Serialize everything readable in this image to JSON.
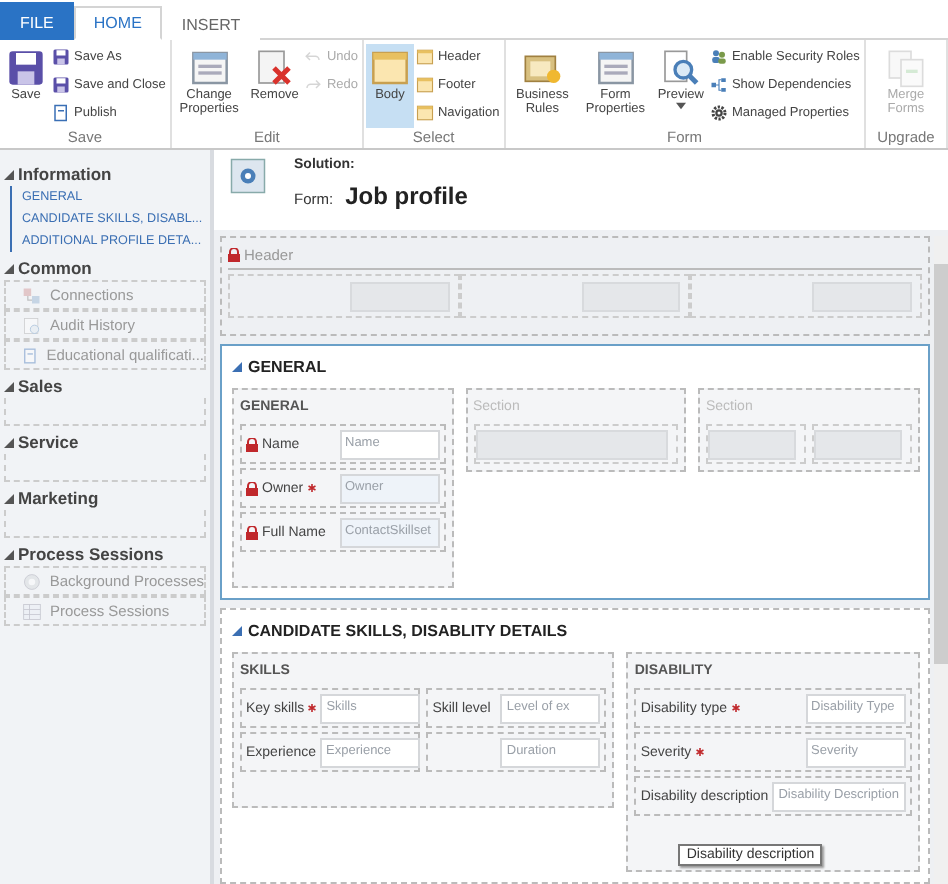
{
  "tabs": [
    {
      "label": "FILE",
      "kind": "file",
      "selected": false
    },
    {
      "label": "HOME",
      "kind": "tab",
      "selected": true
    },
    {
      "label": "INSERT",
      "kind": "tab",
      "selected": false
    }
  ],
  "ribbon_groups": [
    {
      "label": "Save",
      "columns": [
        [
          {
            "label": "Save",
            "kind": "large",
            "selected": false,
            "disabled": false
          }
        ],
        [
          {
            "label": "Save As",
            "kind": "small",
            "selected": false,
            "disabled": false
          },
          {
            "label": "Save and Close",
            "kind": "small",
            "selected": false,
            "disabled": false
          },
          {
            "label": "Publish",
            "kind": "small",
            "selected": false,
            "disabled": false
          }
        ]
      ]
    },
    {
      "label": "Edit",
      "columns": [
        [
          {
            "label": "Change Properties",
            "kind": "large",
            "selected": false,
            "disabled": false
          }
        ],
        [
          {
            "label": "Remove",
            "kind": "large",
            "selected": false,
            "disabled": false
          }
        ],
        [
          {
            "label": "Undo",
            "kind": "small",
            "selected": false,
            "disabled": true
          },
          {
            "label": "Redo",
            "kind": "small",
            "selected": false,
            "disabled": true
          }
        ]
      ]
    },
    {
      "label": "Select",
      "columns": [
        [
          {
            "label": "Body",
            "kind": "large",
            "selected": true,
            "disabled": false
          }
        ],
        [
          {
            "label": "Header",
            "kind": "small",
            "selected": false,
            "disabled": false
          },
          {
            "label": "Footer",
            "kind": "small",
            "selected": false,
            "disabled": false
          },
          {
            "label": "Navigation",
            "kind": "small",
            "selected": false,
            "disabled": false
          }
        ]
      ]
    },
    {
      "label": "Form",
      "columns": [
        [
          {
            "label": "Business Rules",
            "kind": "large",
            "selected": false,
            "disabled": false
          }
        ],
        [
          {
            "label": "Form Properties",
            "kind": "large",
            "selected": false,
            "disabled": false
          }
        ],
        [
          {
            "label": "Preview",
            "kind": "dropdown",
            "selected": false,
            "disabled": false
          }
        ],
        [
          {
            "label": "Enable Security Roles",
            "kind": "small",
            "selected": false,
            "disabled": false
          },
          {
            "label": "Show Dependencies",
            "kind": "small",
            "selected": false,
            "disabled": false
          },
          {
            "label": "Managed Properties",
            "kind": "small",
            "selected": false,
            "disabled": false
          }
        ]
      ]
    },
    {
      "label": "Upgrade",
      "columns": [
        [
          {
            "label": "Merge Forms",
            "kind": "large",
            "selected": false,
            "disabled": true
          }
        ]
      ]
    }
  ],
  "nav": [
    {
      "title": "Information",
      "items": [
        {
          "label": "GENERAL",
          "kind": "link"
        },
        {
          "label": "CANDIDATE SKILLS, DISABL...",
          "kind": "link"
        },
        {
          "label": "ADDITIONAL PROFILE DETA...",
          "kind": "link"
        }
      ]
    },
    {
      "title": "Common",
      "items": [
        {
          "label": "Connections",
          "kind": "item"
        },
        {
          "label": "Audit History",
          "kind": "item"
        },
        {
          "label": "Educational qualificati...",
          "kind": "item"
        }
      ]
    },
    {
      "title": "Sales"
    },
    {
      "title": "Service"
    },
    {
      "title": "Marketing"
    },
    {
      "title": "Process Sessions",
      "items": [
        {
          "label": "Background Processes",
          "kind": "item"
        },
        {
          "label": "Process Sessions",
          "kind": "item"
        }
      ]
    }
  ],
  "solution_label": "Solution:",
  "form_label": "Form:",
  "form_name": "Job profile",
  "header_block": {
    "label": "Header",
    "locked": true
  },
  "form_tabs": [
    {
      "title": "GENERAL",
      "selected": true,
      "sections": [
        {
          "title": "GENERAL",
          "kind": "fields",
          "rows": [
            [
              {
                "label": "Name",
                "locked": true,
                "required": false,
                "placeholder": "Name",
                "kind": "text"
              }
            ],
            [
              {
                "label": "Owner",
                "locked": true,
                "required": true,
                "placeholder": "Owner",
                "kind": "lookup"
              }
            ],
            [
              {
                "label": "Full Name",
                "locked": true,
                "required": false,
                "placeholder": "ContactSkillset",
                "kind": "lookup"
              }
            ]
          ]
        },
        {
          "title": "Section",
          "kind": "blank"
        },
        {
          "title": "Section",
          "kind": "split"
        }
      ]
    },
    {
      "title": "CANDIDATE SKILLS, DISABLITY DETAILS",
      "selected": false,
      "sections": [
        {
          "title": "SKILLS",
          "kind": "fields",
          "rows": [
            [
              {
                "label": "Key skills",
                "locked": false,
                "required": true,
                "placeholder": "Skills",
                "kind": "text"
              },
              {
                "label": "Skill level",
                "locked": false,
                "required": false,
                "placeholder": "Level of ex",
                "kind": "text"
              }
            ],
            [
              {
                "label": "Experience",
                "locked": false,
                "required": false,
                "placeholder": "Experience",
                "kind": "text"
              },
              {
                "placeholder": "Duration",
                "kind": "text"
              }
            ]
          ]
        },
        {
          "title": "DISABILITY",
          "kind": "fields",
          "rows": [
            [
              {
                "label": "Disability type",
                "locked": false,
                "required": true,
                "placeholder": "Disability Type",
                "kind": "text"
              }
            ],
            [
              {
                "label": "Severity",
                "locked": false,
                "required": true,
                "placeholder": "Severity",
                "kind": "text"
              }
            ],
            [
              {
                "label": "Disability description",
                "locked": false,
                "required": false,
                "placeholder": "Disability Description",
                "kind": "text"
              }
            ]
          ],
          "tooltip": "Disability description"
        }
      ]
    }
  ]
}
